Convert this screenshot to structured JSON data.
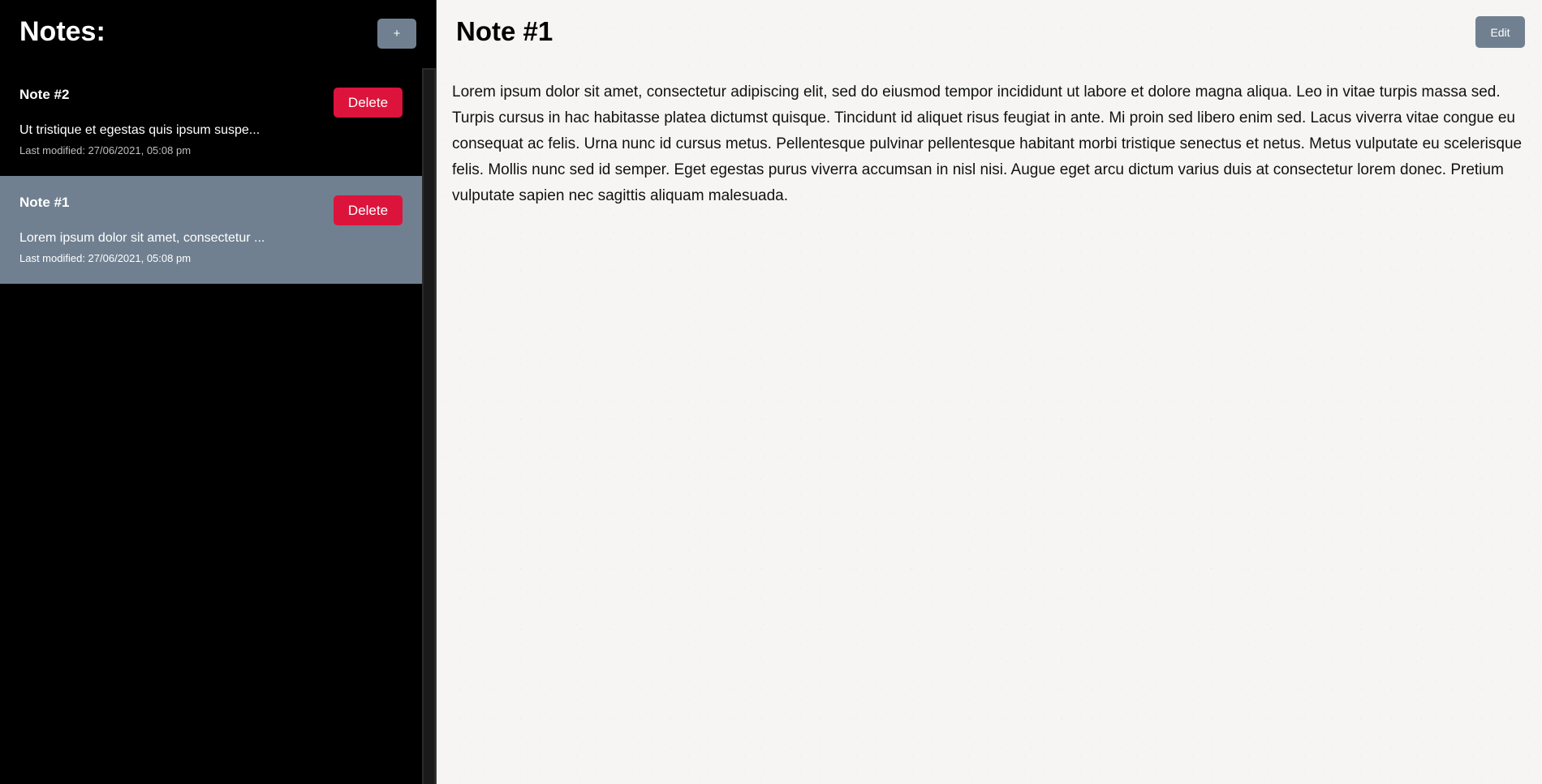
{
  "sidebar": {
    "title": "Notes:",
    "add_label": "+",
    "notes": [
      {
        "title": "Note #2",
        "preview": "Ut tristique et egestas quis ipsum suspe...",
        "modified": "Last modified: 27/06/2021, 05:08 pm",
        "delete_label": "Delete",
        "selected": false
      },
      {
        "title": "Note #1",
        "preview": "Lorem ipsum dolor sit amet, consectetur ...",
        "modified": "Last modified: 27/06/2021, 05:08 pm",
        "delete_label": "Delete",
        "selected": true
      }
    ]
  },
  "main": {
    "title": "Note #1",
    "edit_label": "Edit",
    "body": "Lorem ipsum dolor sit amet, consectetur adipiscing elit, sed do eiusmod tempor incididunt ut labore et dolore magna aliqua. Leo in vitae turpis massa sed. Turpis cursus in hac habitasse platea dictumst quisque. Tincidunt id aliquet risus feugiat in ante. Mi proin sed libero enim sed. Lacus viverra vitae congue eu consequat ac felis. Urna nunc id cursus metus. Pellentesque pulvinar pellentesque habitant morbi tristique senectus et netus. Metus vulputate eu scelerisque felis. Mollis nunc sed id semper. Eget egestas purus viverra accumsan in nisl nisi. Augue eget arcu dictum varius duis at consectetur lorem donec. Pretium vulputate sapien nec sagittis aliquam malesuada."
  },
  "colors": {
    "sidebar_bg": "#000000",
    "selected_bg": "#708090",
    "accent_button": "#708090",
    "delete_button": "#dc143c",
    "main_bg": "#f6f5f3"
  }
}
